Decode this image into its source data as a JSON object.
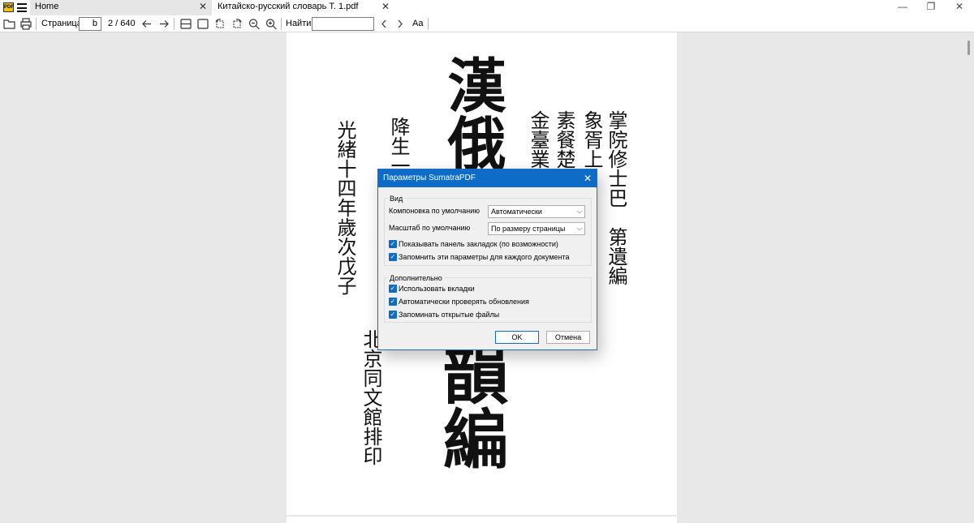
{
  "tabs": [
    {
      "label": "Home"
    },
    {
      "label": "Китайско-русский словарь Т. 1.pdf"
    }
  ],
  "window": {
    "minimize": "—",
    "restore": "❐",
    "close": "✕",
    "tab_close": "✕"
  },
  "toolbar": {
    "page_label": "Страница:",
    "page_value": "b",
    "page_count": "2 / 640",
    "find_label": "Найти:",
    "find_value": "",
    "case_glyph": "Aa",
    "icons": [
      "open-icon",
      "print-icon",
      "prev-page-icon",
      "next-page-icon",
      "single-page-icon",
      "fit-page-icon",
      "rotate-left-icon",
      "rotate-right-icon",
      "zoom-out-icon",
      "zoom-in-icon",
      "find-prev-icon",
      "find-next-icon",
      "match-case-icon"
    ]
  },
  "document": {
    "title_chars": "漢俄",
    "title_chars_bottom": "韻編",
    "col_left1": "光緒十四年歲次戊子",
    "col_left2": "降生一",
    "col_left3": "北京同文館排印",
    "col_right1": "金臺業",
    "col_right2": "素餐楚",
    "col_right3": "象胥上",
    "col_right4": "掌院修士巴",
    "col_right5": "第遺編"
  },
  "dialog": {
    "title": "Параметры SumatraPDF",
    "close": "✕",
    "view_group": "Вид",
    "layout_label": "Компоновка по умолчанию",
    "layout_value": "Автоматически",
    "zoom_label": "Масштаб по умолчанию",
    "zoom_value": "По размеру страницы",
    "cb_bookmarks": "Показывать панель закладок (по возможности)",
    "cb_remember": "Запомнить эти параметры для каждого документа",
    "advanced_group": "Дополнительно",
    "cb_tabs": "Использовать вкладки",
    "cb_updates": "Автоматически проверять обновления",
    "cb_open_files": "Запоминать открытые файлы",
    "ok": "OK",
    "cancel": "Отмена",
    "check_glyph": "✓",
    "arrow_glyph": "⌵"
  },
  "colors": {
    "accent": "#0e6cc9",
    "page": "#ffffff",
    "background": "#e8e8e8"
  }
}
